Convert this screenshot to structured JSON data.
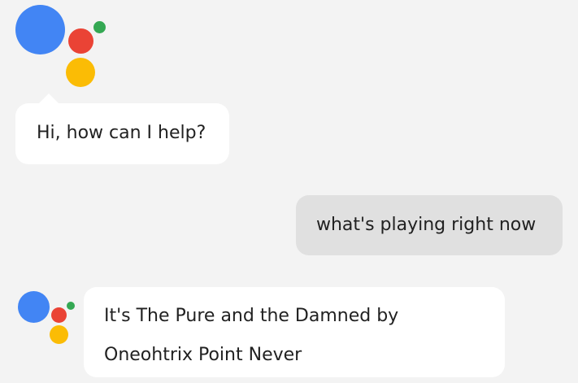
{
  "colors": {
    "background": "#f3f3f3",
    "assistant_bubble": "#ffffff",
    "user_bubble": "#e0e0e0",
    "text": "#212121",
    "logo_blue": "#4285f4",
    "logo_red": "#ea4335",
    "logo_green": "#34a853",
    "logo_yellow": "#fbbc05"
  },
  "icons": {
    "large_logo": "google-assistant-logo",
    "small_logo": "google-assistant-logo"
  },
  "conversation": {
    "greeting": "Hi, how can I help?",
    "user_query": "what's playing right now",
    "response_line_1": "It's The Pure and the Damned by",
    "response_line_2": "Oneohtrix Point Never"
  }
}
